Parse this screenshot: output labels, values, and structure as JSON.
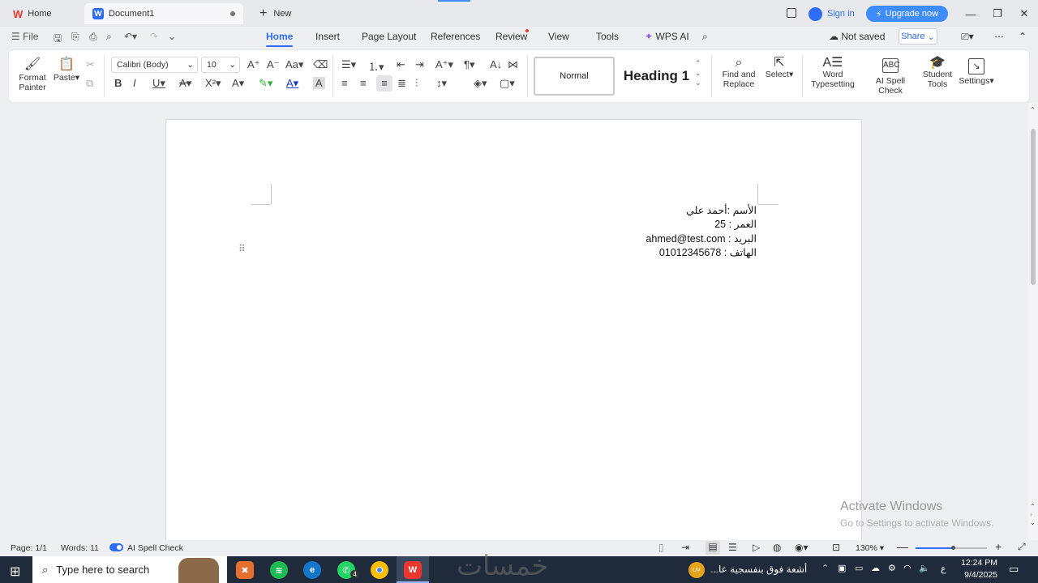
{
  "tabs": {
    "home": "Home",
    "document": "Document1",
    "new": "New"
  },
  "titlebar": {
    "sign_in": "Sign in",
    "upgrade": "Upgrade now"
  },
  "menu": {
    "file": "File",
    "home": "Home",
    "insert": "Insert",
    "page_layout": "Page Layout",
    "references": "References",
    "review": "Review",
    "view": "View",
    "tools": "Tools",
    "wps_ai": "WPS AI",
    "not_saved": "Not saved",
    "share": "Share"
  },
  "ribbon": {
    "format_painter": "Format\nPainter",
    "paste": "Paste",
    "font_name": "Calibri (Body)",
    "font_size": "10",
    "style_normal": "Normal",
    "style_heading1": "Heading 1",
    "find_replace": "Find and\nReplace",
    "select": "Select",
    "word_typesetting": "Word\nTypesetting",
    "ai_spell_check": "AI Spell Check",
    "student_tools": "Student\nTools",
    "settings": "Settings"
  },
  "document": {
    "lines": [
      "الأسم :أحمد علي",
      "العمر : 25",
      "البريد : ahmed@test.com",
      "الهاتف : 01012345678"
    ]
  },
  "statusbar": {
    "page": "Page: 1/1",
    "words": "Words: 11",
    "ai_spell": "AI Spell Check",
    "zoom": "130%"
  },
  "watermark": {
    "title": "Activate Windows",
    "subtitle": "Go to Settings to activate Windows."
  },
  "taskbar": {
    "search_placeholder": "Type here to search",
    "whatsapp_badge": "4",
    "weather_text": "أشعة فوق بنفسجية عا...",
    "weather_badge": "UV",
    "lang": "ع",
    "time": "12:24 PM",
    "date": "9/4/2025"
  },
  "colors": {
    "accent": "#2e6cf6",
    "upgrade": "#3f8cff",
    "taskbar": "#1f2b3a"
  }
}
